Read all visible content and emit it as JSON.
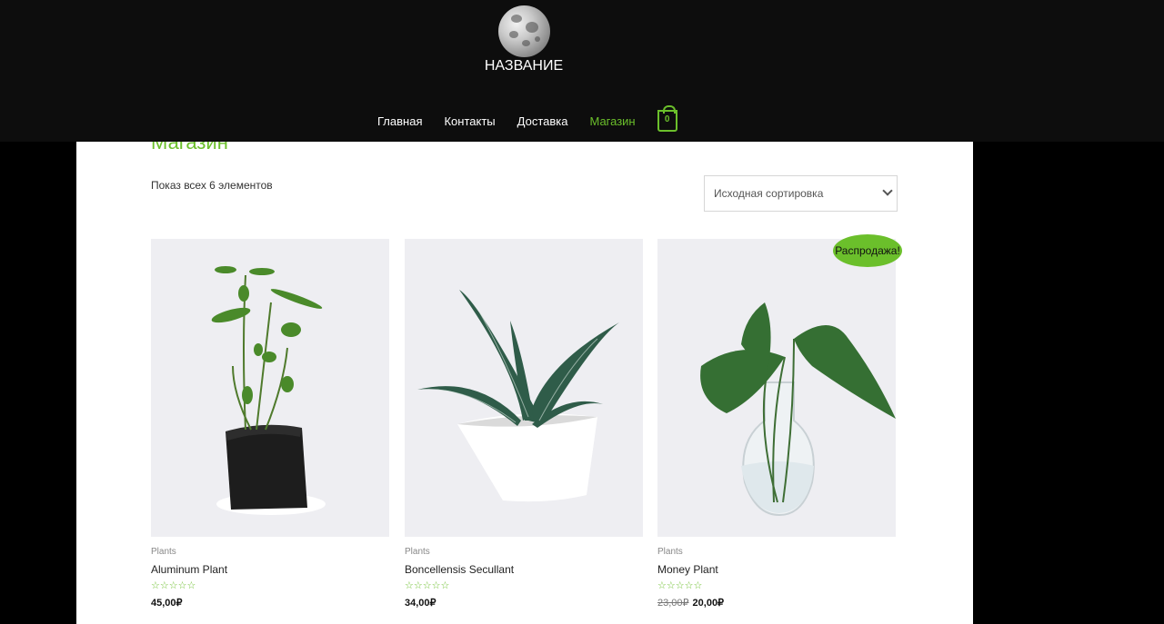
{
  "header": {
    "site_title": "НАЗВАНИЕ",
    "nav": [
      {
        "label": "Главная",
        "active": false
      },
      {
        "label": "Контакты",
        "active": false
      },
      {
        "label": "Доставка",
        "active": false
      },
      {
        "label": "Магазин",
        "active": true
      }
    ],
    "cart_count": "0"
  },
  "shop": {
    "title": "Магазин",
    "result_count": "Показ всех 6 элементов",
    "sort_selected": "Исходная сортировка",
    "sale_badge": "Распродажа!",
    "products": [
      {
        "category": "Plants",
        "name": "Aluminum Plant",
        "stars": "☆☆☆☆☆",
        "old_price": "",
        "price": "45,00₽"
      },
      {
        "category": "Plants",
        "name": "Boncellensis Secullant",
        "stars": "☆☆☆☆☆",
        "old_price": "",
        "price": "34,00₽"
      },
      {
        "category": "Plants",
        "name": "Money Plant",
        "stars": "☆☆☆☆☆",
        "old_price": "23,00₽",
        "price": "20,00₽"
      }
    ]
  },
  "colors": {
    "accent": "#6bbf2b",
    "header_bg": "#0d0d0d",
    "card_bg": "#eeeef2"
  }
}
